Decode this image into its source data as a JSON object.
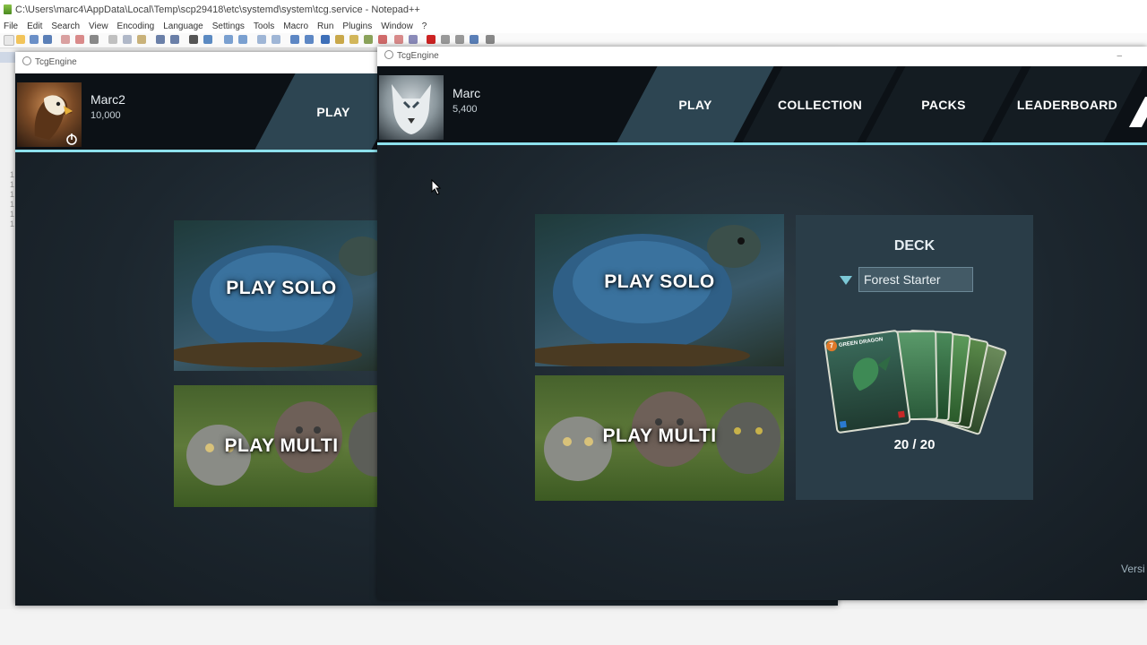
{
  "editor": {
    "title_path": "C:\\Users\\marc4\\AppData\\Local\\Temp\\scp29418\\etc\\systemd\\system\\tcg.service - Notepad++",
    "menu": [
      "File",
      "Edit",
      "Search",
      "View",
      "Encoding",
      "Language",
      "Settings",
      "Tools",
      "Macro",
      "Run",
      "Plugins",
      "Window",
      "?"
    ],
    "line_numbers": [
      "1",
      "1",
      "1",
      "1",
      "1",
      "1"
    ]
  },
  "back_window": {
    "title": "TcgEngine",
    "player": {
      "name": "Marc2",
      "coins": "10,000"
    },
    "tabs": [
      {
        "label": "PLAY"
      }
    ],
    "modes": {
      "solo": "PLAY SOLO",
      "multi": "PLAY MULTI"
    }
  },
  "front_window": {
    "title": "TcgEngine",
    "player": {
      "name": "Marc",
      "coins": "5,400"
    },
    "tabs": [
      {
        "label": "PLAY"
      },
      {
        "label": "COLLECTION"
      },
      {
        "label": "PACKS"
      },
      {
        "label": "LEADERBOARD"
      }
    ],
    "modes": {
      "solo": "PLAY SOLO",
      "multi": "PLAY MULTI"
    },
    "deck": {
      "title": "DECK",
      "selected": "Forest Starter",
      "count": "20 / 20",
      "top_card_name": "GREEN DRAGON",
      "top_card_cost": "7"
    },
    "version_text": "Versi"
  },
  "colors": {
    "accent": "#8de0ec",
    "header_bg": "#0c1116",
    "active_tab": "#2d4552",
    "deck_panel": "#2a3d48"
  }
}
